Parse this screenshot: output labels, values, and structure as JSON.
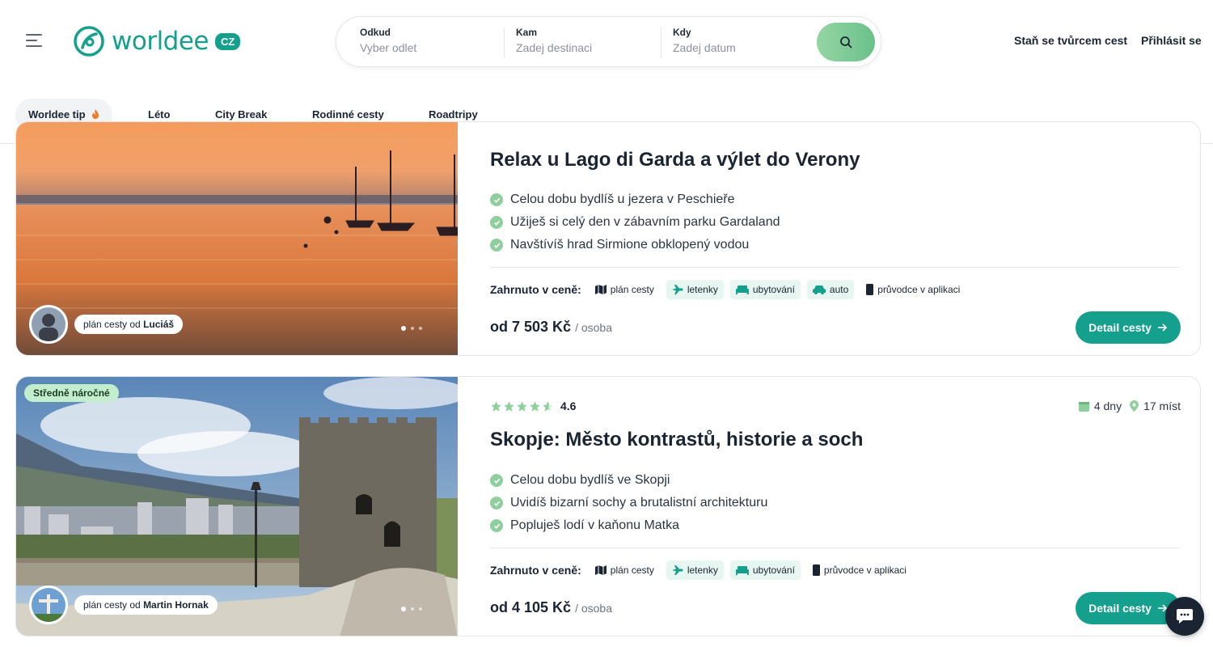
{
  "brand": {
    "name": "worldee",
    "badge": "CZ",
    "color": "#15a08d"
  },
  "search": {
    "from": {
      "label": "Odkud",
      "placeholder": "Vyber odlet"
    },
    "to": {
      "label": "Kam",
      "placeholder": "Zadej destinaci"
    },
    "when": {
      "label": "Kdy",
      "placeholder": "Zadej datum"
    }
  },
  "header_links": {
    "creator": "Staň se tvůrcem cest",
    "login": "Přihlásit se"
  },
  "categories": [
    "Worldee tip",
    "Léto",
    "City Break",
    "Rodinné cesty",
    "Roadtripy"
  ],
  "trips": [
    {
      "title": "Relax u Lago di Garda a výlet do Verony",
      "bullets": [
        "Celou dobu bydlíš u jezera v Peschieře",
        "Užiješ si celý den v zábavním parku Gardaland",
        "Navštívíš hrad Sirmione obklopený vodou"
      ],
      "included_label": "Zahrnuto v ceně:",
      "included": [
        "plán cesty",
        "letenky",
        "ubytování",
        "auto",
        "průvodce v aplikaci"
      ],
      "price": "od 7 503 Kč",
      "per": "/ osoba",
      "author_prefix": "plán cesty od",
      "author": "Luciáš",
      "button": "Detail cesty"
    },
    {
      "difficulty": "Středně náročné",
      "rating": "4.6",
      "days": "4 dny",
      "places": "17 míst",
      "title": "Skopje: Město kontrastů, historie a soch",
      "bullets": [
        "Celou dobu bydlíš ve Skopji",
        "Uvidíš bizarní sochy a brutalistní architekturu",
        "Popluješ lodí v kaňonu Matka"
      ],
      "included_label": "Zahrnuto v ceně:",
      "included": [
        "plán cesty",
        "letenky",
        "ubytování",
        "průvodce v aplikaci"
      ],
      "price": "od 4 105 Kč",
      "per": "/ osoba",
      "author_prefix": "plán cesty od",
      "author": "Martin Hornak",
      "button": "Detail cesty"
    }
  ],
  "icons": {
    "menu": "hamburger-icon",
    "search": "search-icon",
    "flame": "flame-icon",
    "check": "check-icon",
    "map": "map-icon",
    "plane": "plane-icon",
    "bed": "bed-icon",
    "car": "car-icon",
    "phone": "phone-icon",
    "arrow": "arrow-right-icon",
    "star": "star-icon",
    "calendar": "calendar-icon",
    "pin": "pin-icon",
    "chat": "chat-icon"
  }
}
